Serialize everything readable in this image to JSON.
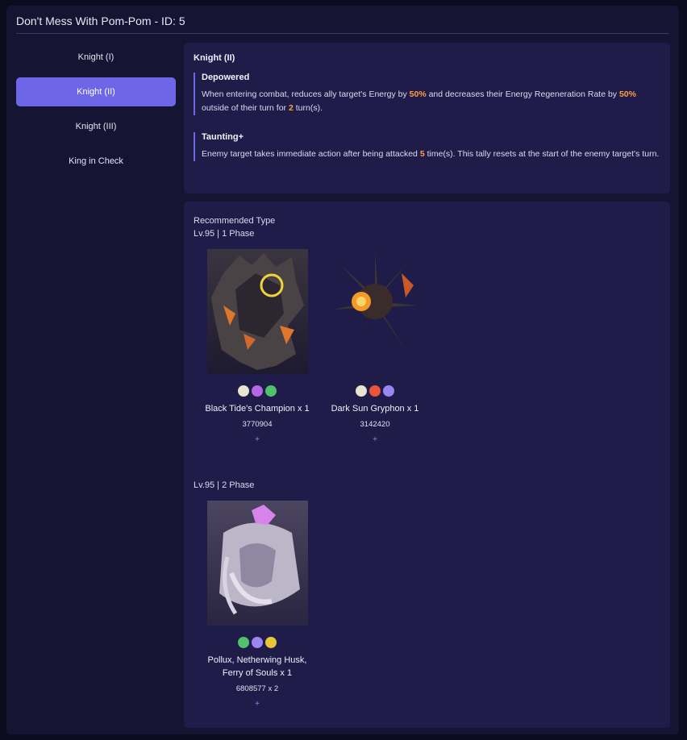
{
  "header": {
    "title": "Don't Mess With Pom-Pom - ID: 5"
  },
  "sidebar": {
    "items": [
      {
        "label": "Knight (I)"
      },
      {
        "label": "Knight (II)"
      },
      {
        "label": "Knight (III)"
      },
      {
        "label": "King in Check"
      }
    ],
    "active_index": 1
  },
  "detail": {
    "title": "Knight (II)",
    "effects": [
      {
        "name": "Depowered",
        "desc_1": "When entering combat, reduces ally target's Energy by ",
        "value_1": "50%",
        "desc_2": " and decreases their Energy Regeneration Rate by ",
        "value_2": "50%",
        "desc_3": " outside of their turn for ",
        "value_3": "2",
        "desc_4": " turn(s)."
      },
      {
        "name": "Taunting+",
        "desc_1": "Enemy target takes immediate action after being attacked ",
        "value_1": "5",
        "desc_2": " time(s). This tally resets at the start of the enemy target's turn."
      }
    ]
  },
  "enemies": {
    "heading": "Recommended Type",
    "phases": [
      {
        "label": "Lv.95 | 1 Phase",
        "enemies": [
          {
            "name": "Black Tide's Champion x 1",
            "hp": "3770904",
            "add": "+",
            "weaknesses": [
              "imaginary-icon",
              "quantum-icon",
              "wind-icon"
            ]
          },
          {
            "name": "Dark Sun Gryphon x 1",
            "hp": "3142420",
            "add": "+",
            "weaknesses": [
              "imaginary-icon",
              "fire-icon",
              "quantum-icon"
            ]
          }
        ]
      },
      {
        "label": "Lv.95 | 2 Phase",
        "enemies": [
          {
            "name": "Pollux, Netherwing Husk, Ferry of Souls x 1",
            "hp": "6808577 x 2",
            "add": "+",
            "weaknesses": [
              "wind-icon",
              "quantum-icon",
              "imaginary-icon"
            ]
          }
        ]
      }
    ]
  },
  "colors": {
    "accent": "#6d67e8",
    "highlight": "#ff9f43",
    "card": "#1f1c4a",
    "background": "#161433"
  }
}
